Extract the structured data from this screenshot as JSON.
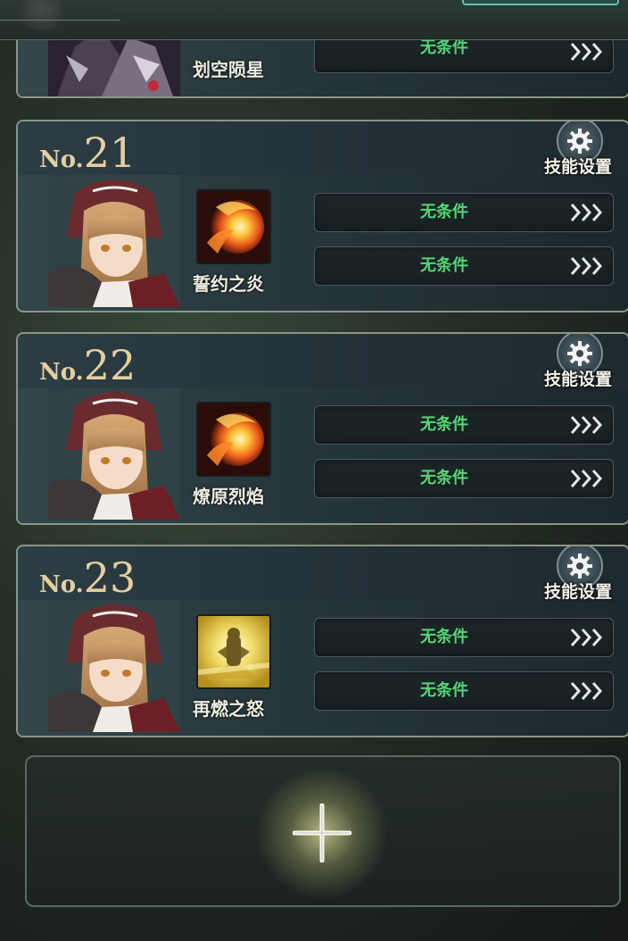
{
  "top_card": {
    "skill_name": "划空陨星",
    "condition": "无条件"
  },
  "gear_label": "技能设置",
  "cards": [
    {
      "no_prefix": "No.",
      "no_number": "21",
      "skill_name": "誓约之炎",
      "skill_icon": "fireball-icon",
      "conditions": [
        "无条件",
        "无条件"
      ]
    },
    {
      "no_prefix": "No.",
      "no_number": "22",
      "skill_name": "燎原烈焰",
      "skill_icon": "fireball-icon",
      "conditions": [
        "无条件",
        "无条件"
      ]
    },
    {
      "no_prefix": "No.",
      "no_number": "23",
      "skill_name": "再燃之怒",
      "skill_icon": "golden-statue-icon",
      "conditions": [
        "无条件",
        "无条件"
      ]
    }
  ],
  "add_button": {
    "icon": "plus-icon"
  },
  "colors": {
    "condition_text": "#4fd873",
    "number_gold": "#e3cf9f"
  }
}
